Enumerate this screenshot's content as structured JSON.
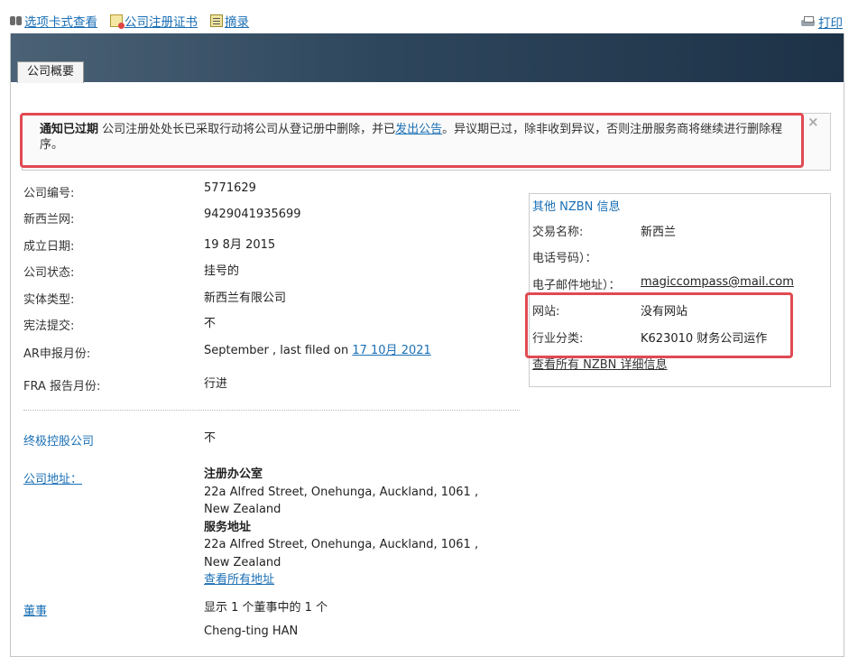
{
  "toplinks": {
    "tab_view": "选项卡式查看",
    "certificate": "公司注册证书",
    "summary": "摘录",
    "print": "打印"
  },
  "tab": {
    "label": "公司概要"
  },
  "alert": {
    "title": "通知已过期",
    "text_before": " 公司注册处处长已采取行动将公司从登记册中删除，并已",
    "link": "发出公告",
    "text_after": "。异议期已过，除非收到异议，否则注册服务商将继续进行删除程序。",
    "close": "×"
  },
  "fields": {
    "company_number_label": "公司编号:",
    "company_number": "5771629",
    "nzbn_label": "新西兰网:",
    "nzbn": "9429041935699",
    "incorporation_label": "成立日期:",
    "incorporation": "19 8月 2015",
    "status_label": "公司状态:",
    "status": "挂号的",
    "entity_type_label": "实体类型:",
    "entity_type": "新西兰有限公司",
    "constitution_label": "宪法提交:",
    "constitution": "不",
    "ar_month_label": "AR申报月份:",
    "ar_month_text": "September , last filed on ",
    "ar_month_link": "17 10月 2021",
    "fra_label": "FRA 报告月份:",
    "fra": "行进",
    "ultimate_holding_label": "终极控股公司",
    "ultimate_holding": "不",
    "address_label": "公司地址：",
    "registered_office_title": "注册办公室",
    "registered_line1": "22a Alfred Street, Onehunga, Auckland, 1061 ,",
    "registered_line2": "New Zealand",
    "service_title": "服务地址",
    "service_line1": "22a Alfred Street, Onehunga, Auckland, 1061 ,",
    "service_line2": "New Zealand",
    "view_all_addresses": "查看所有地址",
    "directors_label": "董事",
    "directors_count": "显示 1 个董事中的 1 个",
    "director_name": "Cheng-ting HAN"
  },
  "nzbn_box": {
    "title": "其他 NZBN 信息",
    "trading_name_label": "交易名称:",
    "trading_name": "新西兰",
    "phone_label": "电话号码）：",
    "email_label": "电子邮件地址）：",
    "email": "magiccompass@mail.com",
    "website_label": "网站:",
    "website": "没有网站",
    "industry_label": "行业分类:",
    "industry": "K623010 财务公司运作",
    "view_all": "查看所有 NZBN 详细信息"
  },
  "colors": {
    "link": "#1a6fb5",
    "highlight_red": "#e04a52",
    "header_dark": "#1d3247"
  }
}
